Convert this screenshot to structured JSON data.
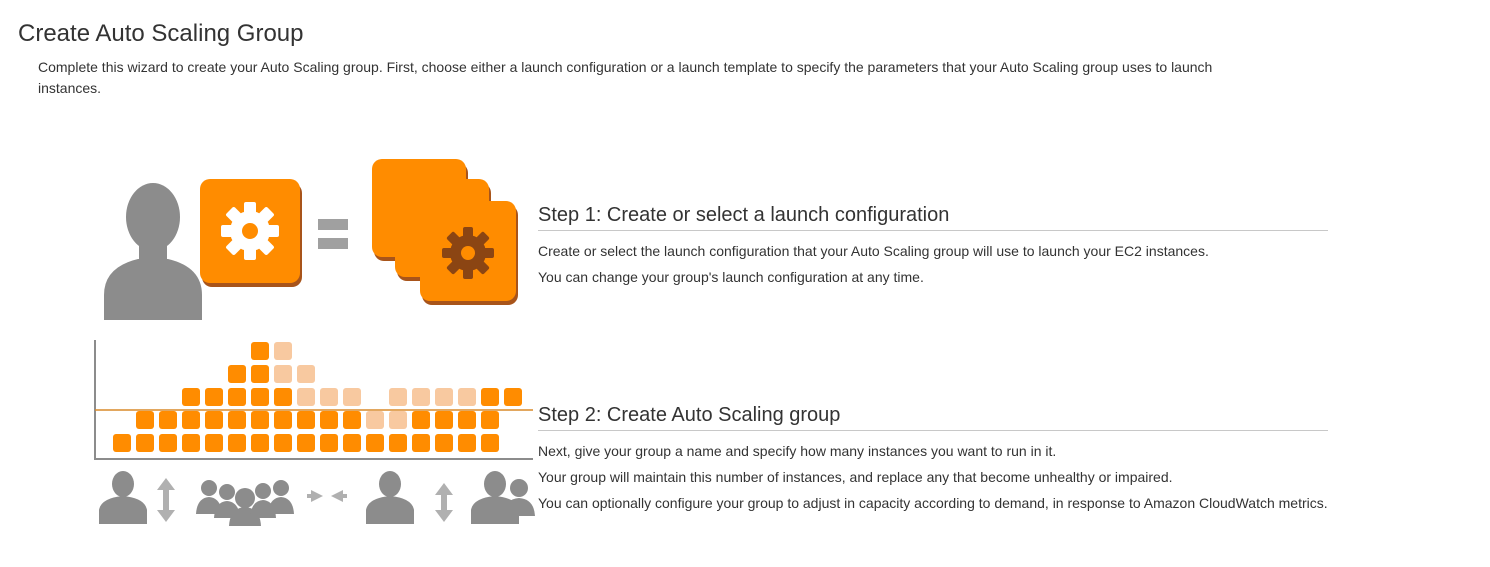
{
  "page": {
    "title": "Create Auto Scaling Group",
    "intro": "Complete this wizard to create your Auto Scaling group. First, choose either a launch configuration or a launch template to specify the parameters that your Auto Scaling group uses to launch instances."
  },
  "steps": [
    {
      "title": "Step 1: Create or select a launch configuration",
      "lines": [
        "Create or select the launch configuration that your Auto Scaling group will use to launch your EC2 instances.",
        "You can change your group's launch configuration at any time."
      ]
    },
    {
      "title": "Step 2: Create Auto Scaling group",
      "lines": [
        "Next, give your group a name and specify how many instances you want to run in it.",
        "Your group will maintain this number of instances, and replace any that become unhealthy or impaired.",
        "You can optionally configure your group to adjust in capacity according to demand, in response to Amazon CloudWatch metrics."
      ]
    }
  ],
  "colors": {
    "orange": "#ff8c00",
    "orange_light": "#f8c9a0",
    "orange_dark": "#a8541a",
    "gear_brown": "#8b4513",
    "person_gray": "#8c8c8c",
    "line_gray": "#c8c8c8"
  },
  "icons": [
    "person-icon",
    "gear-icon",
    "equals-icon",
    "stacked-config-icon",
    "instance-grid-icon",
    "up-down-arrow-icon",
    "group-icon",
    "converge-arrows-icon"
  ]
}
